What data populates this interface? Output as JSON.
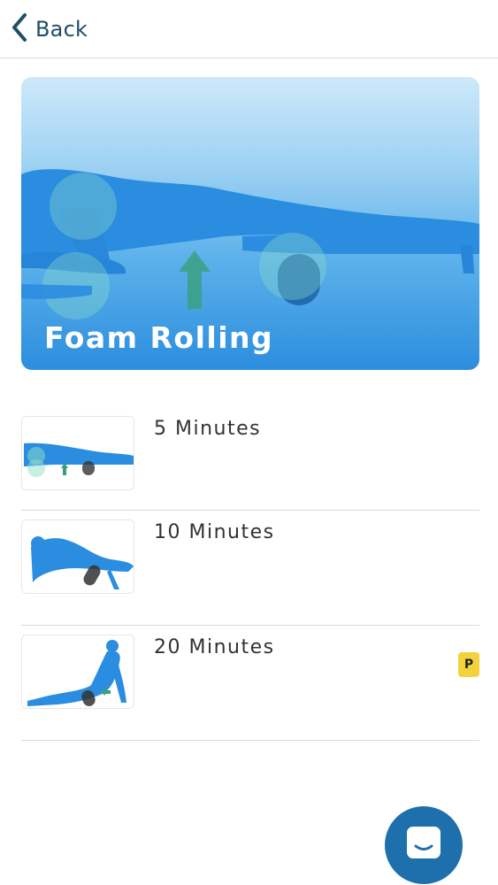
{
  "nav": {
    "back_label": "Back"
  },
  "hero": {
    "title": "Foam Rolling"
  },
  "workouts": [
    {
      "label": "5 Minutes",
      "premium": false
    },
    {
      "label": "10 Minutes",
      "premium": false
    },
    {
      "label": "20 Minutes",
      "premium": true,
      "badge": "P"
    }
  ],
  "icons": {
    "back": "chevron-left-icon",
    "chat": "chat-bubble-icon",
    "premium": "premium-badge-icon"
  },
  "colors": {
    "accent": "#1f4e66",
    "figure": "#2b8de0",
    "chat_button": "#1e70ad",
    "premium_badge": "#f4d23b"
  }
}
